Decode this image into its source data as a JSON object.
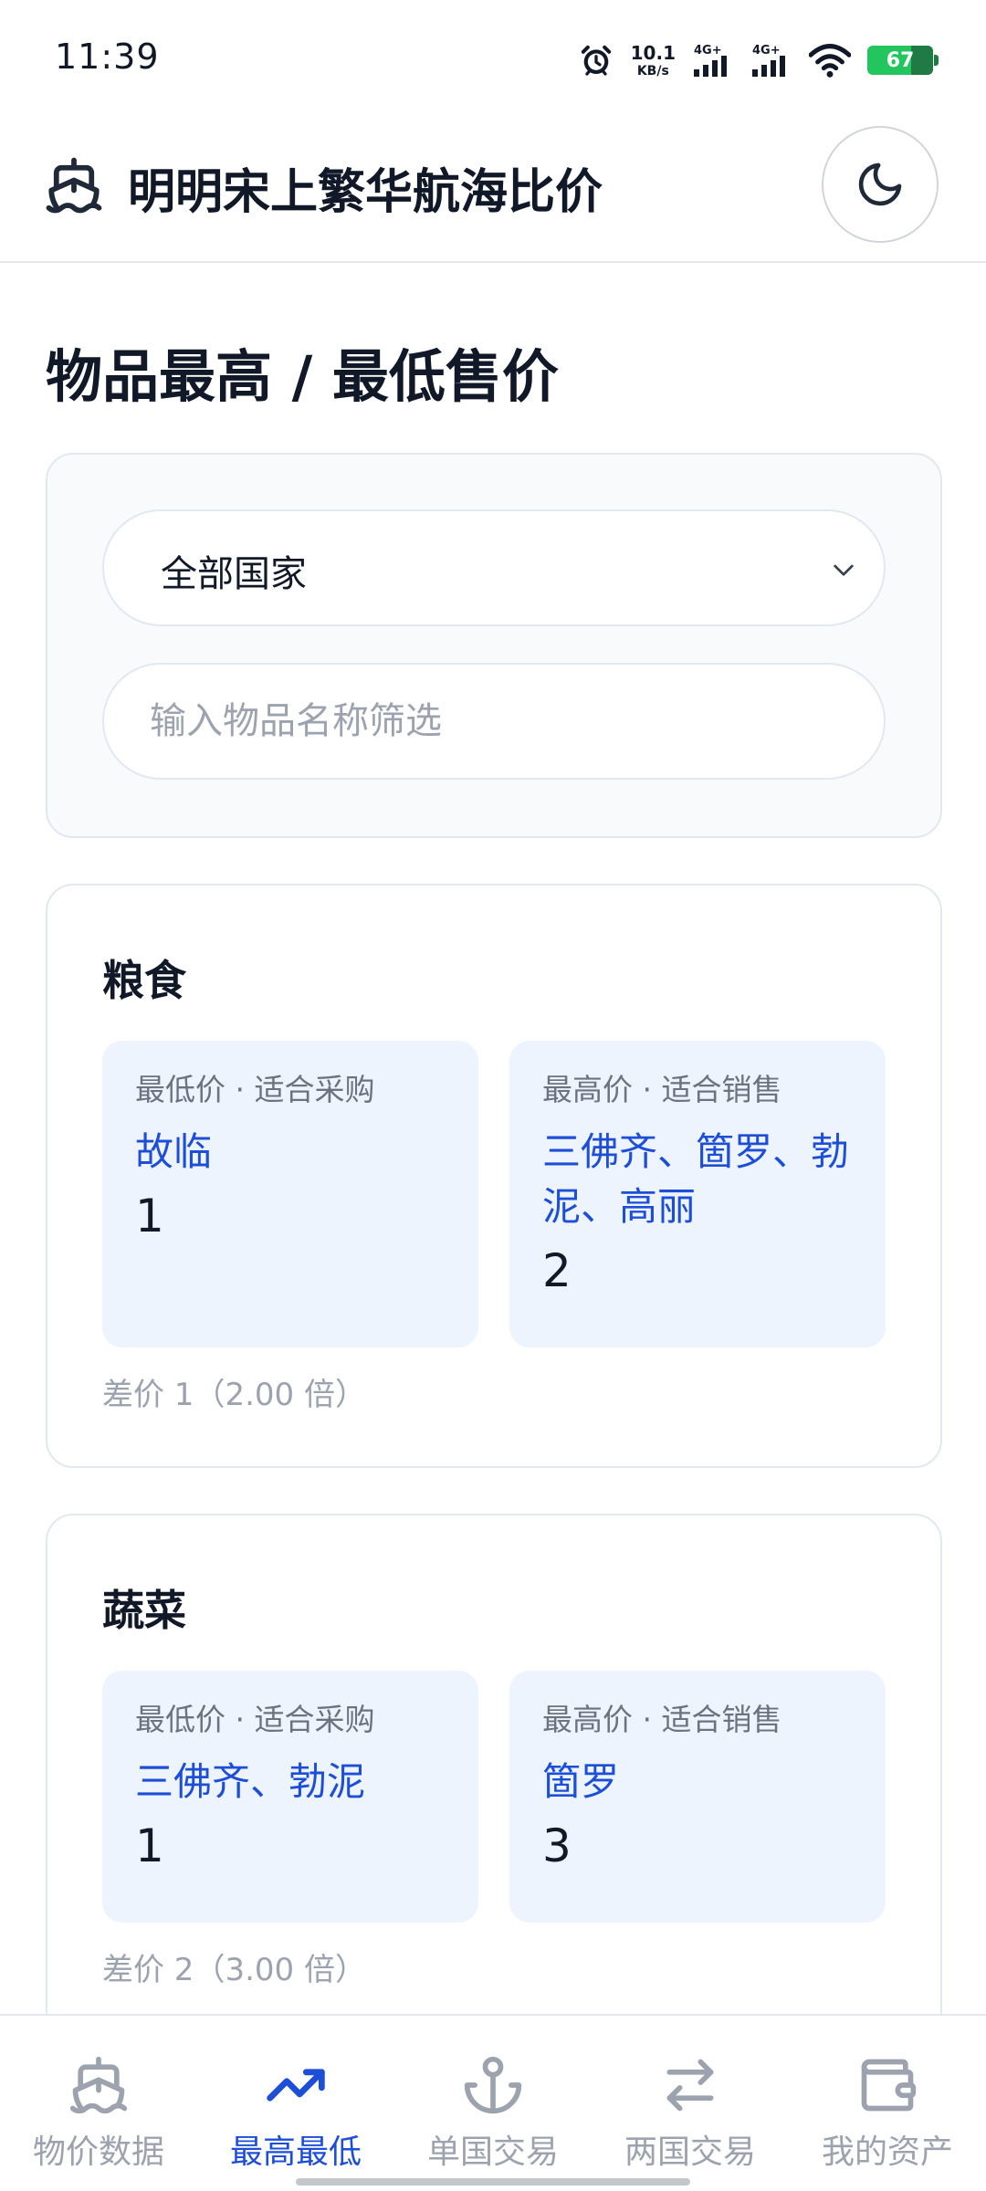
{
  "status_bar": {
    "time": "11:39",
    "net_speed_value": "10.1",
    "net_speed_unit": "KB/s",
    "signal1": "4G+",
    "signal2": "4G+",
    "battery": "67"
  },
  "header": {
    "title": "明明宋上繁华航海比价",
    "brand_icon": "ship-icon",
    "theme_icon": "moon-icon"
  },
  "page": {
    "title": "物品最高 / 最低售价"
  },
  "filters": {
    "country_selected": "全部国家",
    "name_placeholder": "输入物品名称筛选"
  },
  "items": [
    {
      "name": "粮食",
      "low": {
        "label": "最低价 · 适合采购",
        "countries": "故临",
        "price": "1"
      },
      "high": {
        "label": "最高价 · 适合销售",
        "countries": "三佛齐、箇罗、勃泥、高丽",
        "price": "2"
      },
      "diff": "差价 1（2.00 倍）"
    },
    {
      "name": "蔬菜",
      "low": {
        "label": "最低价 · 适合采购",
        "countries": "三佛齐、勃泥",
        "price": "1"
      },
      "high": {
        "label": "最高价 · 适合销售",
        "countries": "箇罗",
        "price": "3"
      },
      "diff": "差价 2（3.00 倍）"
    }
  ],
  "bottom_nav": [
    {
      "label": "物价数据",
      "icon": "ship-icon",
      "active": false
    },
    {
      "label": "最高最低",
      "icon": "trending-up-icon",
      "active": true
    },
    {
      "label": "单国交易",
      "icon": "anchor-icon",
      "active": false
    },
    {
      "label": "两国交易",
      "icon": "swap-icon",
      "active": false
    },
    {
      "label": "我的资产",
      "icon": "wallet-icon",
      "active": false
    }
  ],
  "colors": {
    "accent": "#1d4ed8",
    "price_box_bg": "#eef4fe",
    "battery": "#22c55e",
    "muted": "#9ca3af"
  }
}
